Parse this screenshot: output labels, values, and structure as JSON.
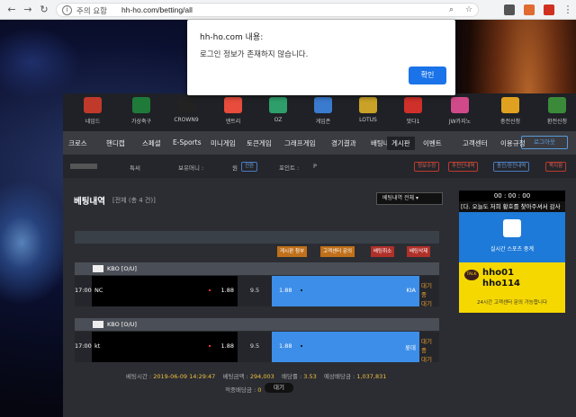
{
  "browser": {
    "security_label": "주의 요함",
    "url": "hh-ho.com/betting/all"
  },
  "alert": {
    "title": "hh-ho.com 내용:",
    "message": "로그인 정보가 존재하지 않습니다.",
    "ok_label": "확인"
  },
  "logos": [
    {
      "label": "네임드",
      "icon": "named-logo-icon",
      "color": "#c0392b"
    },
    {
      "label": "가상축구",
      "icon": "bet365-logo-icon",
      "color": "#1f7a3a"
    },
    {
      "label": "CROWN9",
      "icon": "crown-logo-icon",
      "color": "#222222"
    },
    {
      "label": "엔트리",
      "icon": "entry-logo-icon",
      "color": "#e74c3c"
    },
    {
      "label": "OZ",
      "icon": "oz-logo-icon",
      "color": "#2e9e6a"
    },
    {
      "label": "게임존",
      "icon": "gamezone-logo-icon",
      "color": "#3a7acf"
    },
    {
      "label": "LOTUS",
      "icon": "lotus-logo-icon",
      "color": "#c9a227"
    },
    {
      "label": "맛다1",
      "icon": "game-logo-icon",
      "color": "#d0302a"
    },
    {
      "label": "JW카지노",
      "icon": "jw-casino-logo-icon",
      "color": "#d04a8a"
    },
    {
      "label": "충전신청",
      "icon": "charge-icon",
      "color": "#e0a020"
    },
    {
      "label": "환전신청",
      "icon": "exchange-icon",
      "color": "#3a8a3a"
    }
  ],
  "menu": [
    {
      "label": "크로스"
    },
    {
      "label": "핸디캡"
    },
    {
      "label": "스페셜"
    },
    {
      "label": "E-Sports"
    },
    {
      "label": "미니게임"
    },
    {
      "label": "토큰게임"
    },
    {
      "label": "그래프게임"
    },
    {
      "label": "경기결과"
    },
    {
      "label": "배팅내역"
    },
    {
      "label": "게시판"
    },
    {
      "label": "이벤트"
    },
    {
      "label": "고객센터"
    },
    {
      "label": "이용규정"
    }
  ],
  "logout_label": "로그아웃",
  "info_bar": {
    "grade_label": "특씨",
    "money_label": "보유머니 :",
    "money_value": "원",
    "money_button": "전환",
    "point_label": "포인트 :",
    "point_value": "P",
    "buttons": [
      "정보수정",
      "추천인내역",
      "충전/환전내역",
      "쪽지함"
    ]
  },
  "page": {
    "title": "베팅내역",
    "subtitle": "[전체 (총 4 건)]",
    "filter_label": "베팅내역 전체"
  },
  "actions": [
    "게시판 첨부",
    "고객센터 문의",
    "배팅취소",
    "배팅삭제"
  ],
  "bets": [
    {
      "league": "KBO [O/U]",
      "time": "17:00",
      "home": "NC",
      "home_odds": "1.88",
      "line": "9.5",
      "away_odds": "1.88",
      "away": "KIA",
      "status": "대기",
      "status2": "중",
      "status3": "대기"
    },
    {
      "league": "KBO [O/U]",
      "time": "17:00",
      "home": "kt",
      "home_odds": "1.88",
      "line": "9.5",
      "away_odds": "1.88",
      "away": "롯데",
      "status": "대기",
      "status2": "중",
      "status3": "대기"
    }
  ],
  "summary": {
    "bet_time_label": "베팅시간 :",
    "bet_time": "2019-06-09 14:29:47",
    "amount_label": "베팅금액 :",
    "amount": "294,003",
    "odds_label": "배당률 :",
    "odds": "3.53",
    "expected_label": "예상배당금 :",
    "expected": "1,037,831",
    "paid_label": "적중배당금 :",
    "paid": "0",
    "status": "대기"
  },
  "sidebar": {
    "clock": "00 : 00 : 00",
    "ticker": "[다. 오늘도 저희 황호를 찾아주셔서 감사",
    "live_label": "실시간 스포츠 중계",
    "talk_badge": "TALK",
    "kakao_id1": "hho01",
    "kakao_id2": "hho114",
    "talk_note": "24시간 고객센터 문의 가능합니다"
  }
}
